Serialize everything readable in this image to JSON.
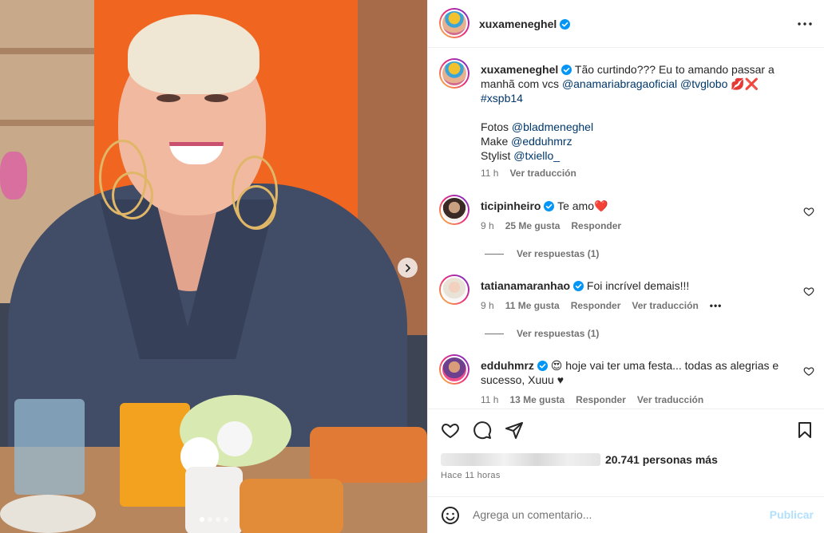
{
  "post_author": "xuxameneghel",
  "caption": {
    "username": "xuxameneghel",
    "text_1": " Tão curtindo??? Eu to amando passar a manhã com vcs ",
    "mention_1": "@anamariabragaoficial",
    "mention_2": "@tvglobo",
    "emojis": " 💋❌",
    "hashtag": "#xspb14",
    "line_fotos": "Fotos ",
    "mention_fotos": "@bladmeneghel",
    "line_make": "Make ",
    "mention_make": "@edduhmrz",
    "line_stylist": "Stylist ",
    "mention_stylist": "@txiello_",
    "time": "11 h",
    "translate": "Ver traducción"
  },
  "comments": [
    {
      "username": "ticipinheiro",
      "text": " Te amo❤️",
      "time": "9 h",
      "likes": "25 Me gusta",
      "reply": "Responder",
      "view_replies": "Ver respuestas (1)"
    },
    {
      "username": "tatianamaranhao",
      "text": " Foi incrível demais!!!",
      "time": "9 h",
      "likes": "11 Me gusta",
      "reply": "Responder",
      "translate": "Ver traducción",
      "more": "•••",
      "view_replies": "Ver respuestas (1)"
    },
    {
      "username": "edduhmrz",
      "text": " 😍 hoje vai ter uma festa... todas as alegrias e sucesso, Xuuu ♥",
      "time": "11 h",
      "likes": "13 Me gusta",
      "reply": "Responder",
      "translate": "Ver traducción"
    }
  ],
  "likes_summary": "20.741 personas más",
  "time_ago": "Hace 11 horas",
  "add_comment": {
    "placeholder": "Agrega un comentario...",
    "publish": "Publicar"
  },
  "carousel": {
    "total": 4,
    "active": 1
  },
  "icons": {
    "more": "more-horizontal-icon",
    "next": "chevron-right-icon",
    "like": "heart-icon",
    "comment": "comment-bubble-icon",
    "share": "paper-plane-icon",
    "save": "bookmark-icon",
    "emoji": "smiley-icon",
    "verified": "verified-badge-icon"
  },
  "colors": {
    "link": "#00376b",
    "verified": "#0095f6",
    "muted": "#737373",
    "publish_disabled": "#b2dffc"
  }
}
